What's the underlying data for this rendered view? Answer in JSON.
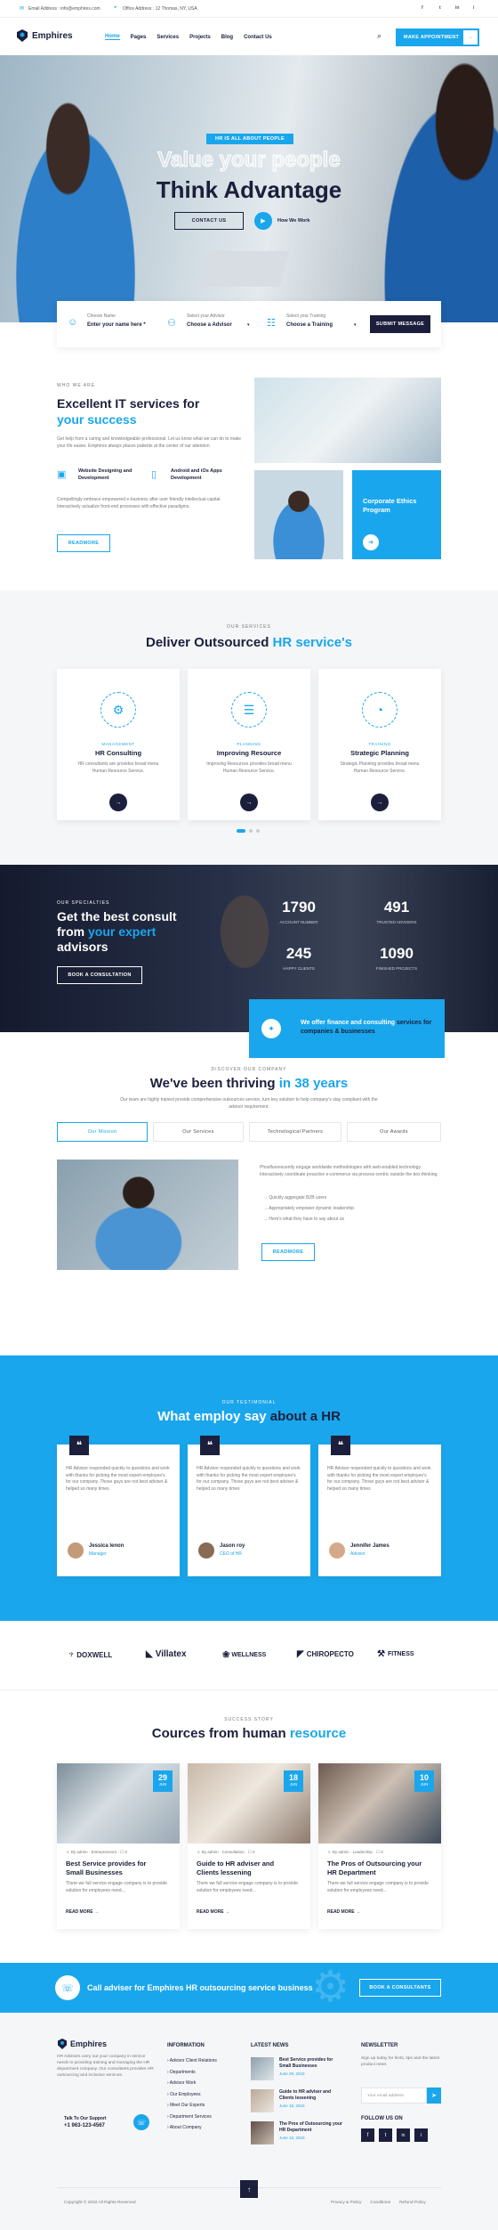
{
  "topbar": {
    "email": "Email Address : info@emphires.com",
    "office": "Office Address : 12 Thomas, NY, USA",
    "social": [
      "f",
      "t",
      "in",
      "i"
    ]
  },
  "header": {
    "logo": "Emphires",
    "nav": [
      "Home",
      "Pages",
      "Services",
      "Projects",
      "Blog",
      "Contact Us"
    ],
    "cta": "MAKE APPOINTMENT"
  },
  "hero": {
    "badge": "HR IS ALL ABOUT PEOPLE",
    "title1": "Value your people",
    "title2": "Think Advantage",
    "contact": "CONTACT US",
    "how": "How We Work"
  },
  "form": {
    "f1_label": "Choose Name",
    "f1_value": "Enter your name here *",
    "f2_label": "Select your Advisor",
    "f2_value": "Choose a Advisor",
    "f3_label": "Select your Training",
    "f3_value": "Choose a Training",
    "submit": "SUBMIT MESSAGE"
  },
  "about": {
    "sub": "WHO WE ARE",
    "title1": "Excellent IT services for",
    "title2": "your success",
    "text": "Get help from a caring and knowledgeable professional. Let us know what we can do to make your life easier. Emphires always places patients at the center of our attention.",
    "f1": "Website Designing and Development",
    "f2": "Android and iOs Apps Development",
    "text2": "Compellingly embrace empowered e-business after user friendly intellectual capital. Interactively actualize front-end processes with effective paradigms.",
    "btn": "READMORE",
    "card": "Corporate Ethics Program"
  },
  "services": {
    "sub": "OUR SERVICES",
    "title1": "Deliver Outsourced ",
    "title2": "HR service's",
    "items": [
      {
        "cat": "MANAGEMENT",
        "title": "HR Consulting",
        "text": "HR consultants are provides broad menu Human Resource Service."
      },
      {
        "cat": "PLANNING",
        "title": "Improving Resource",
        "text": "Improving Resources provides broad menu Human Resource Service."
      },
      {
        "cat": "TRAINING",
        "title": "Strategic Planning",
        "text": "Strategic Planning provides broad menu Human Resource Service."
      }
    ]
  },
  "stats": {
    "sub": "OUR SPECIALTIES",
    "title1": "Get the best consult",
    "title2": "from ",
    "title3": "your expert",
    "title4": "advisors",
    "btn": "BOOK A CONSULTATION",
    "items": [
      {
        "num": "1790",
        "label": "ACCOUNT NUMBER"
      },
      {
        "num": "491",
        "label": "TRUSTED ADVISERS"
      },
      {
        "num": "245",
        "label": "HAPPY CLIENTS"
      },
      {
        "num": "1090",
        "label": "FINISHED PROJECTS"
      }
    ],
    "box1": "We offer finance and consulting ",
    "box2": "services for",
    "box3": "companies & businesses"
  },
  "thriving": {
    "sub": "DISCOVER OUR COMPANY",
    "title1": "We've been thriving ",
    "title2": "in 38 years",
    "text": "Our team are highly trained provide comprehensive outsources service, turn key solution to help company's stay compliant with the advisor requirement.",
    "tabs": [
      "Our Mission",
      "Our Services",
      "Technological Partners",
      "Our Awards"
    ],
    "para": "Phosfluorescently engage worldwide methodologies with web-enabled technology. Interactively coordinate proactive e-commerce via process-centric outside the box thinking.",
    "bullets": [
      "Quickly aggregate B2B users",
      "Appropriately empower dynamic leadership",
      "Here's what they have to say about us"
    ],
    "btn": "READMORE"
  },
  "testimonials": {
    "sub": "OUR TESTIMONIAL",
    "title1": "What employ say ",
    "title2": "about a HR",
    "text": "HR Advisor responded quickly to questions and work with thanks for picking the most expert employee's for our company. Those guys are not best adviser & helped so many times",
    "items": [
      {
        "name": "Jessica lenon",
        "role": "Manager"
      },
      {
        "name": "Jason roy",
        "role": "CEO of HR"
      },
      {
        "name": "Jennifer James",
        "role": "Advisor"
      }
    ]
  },
  "clients": [
    "DOXWELL",
    "Villatex",
    "WELLNESS",
    "CHIROPECTO",
    "FITNESS"
  ],
  "blog": {
    "sub": "SUCCESS STORY",
    "title1": "Cources from human ",
    "title2": "resource",
    "more": "READ MORE",
    "text": "There we full service engage company is to provide solution for employees need...",
    "items": [
      {
        "day": "29",
        "mon": "JUN",
        "meta1": "By admin",
        "meta2": "Entrepreneurs",
        "meta3": "0",
        "title1": "Best Service provides for",
        "title2": "Small Businesses"
      },
      {
        "day": "18",
        "mon": "JUN",
        "meta1": "By admin",
        "meta2": "Consultation",
        "meta3": "0",
        "title1": "Guide to HR adviser and",
        "title2": "Clients lessening"
      },
      {
        "day": "10",
        "mon": "JUN",
        "meta1": "By admin",
        "meta2": "Leadership",
        "meta3": "0",
        "title1": "The Pros of Outsourcing your",
        "title2": "HR Department"
      }
    ]
  },
  "callbar": {
    "text": "Call adviser for Emphires HR outsourcing service business",
    "btn": "BOOK A CONSULTANTS"
  },
  "footer": {
    "logo": "Emphires",
    "about": "HR Advisors carry out your company in service needs to providing training and managing the HR department company. Our consultants provides HR outsourcing and inclusive services.",
    "support_label": "Talk To Our Support",
    "phone": "+1 963-123-4567",
    "info_title": "INFORMATION",
    "info": [
      "Advisor Client Relations",
      "Departments",
      "Advisor Work",
      "Our Employees",
      "Meet Our Experts",
      "Department Services",
      "About Company"
    ],
    "news_title": "LATEST NEWS",
    "news": [
      {
        "t": "Best Service provides for Small Businesses",
        "d": "June 29, 2019"
      },
      {
        "t": "Guide to HR adviser and Clients lessening",
        "d": "June 18, 2019"
      },
      {
        "t": "The Pros of Outsourcing your HR Department",
        "d": "June 10, 2019"
      }
    ],
    "newsletter_title": "NEWSLETTER",
    "newsletter_text": "Sign up today for hints, tips and the latest product news",
    "email_ph": "Your email address",
    "follow": "FOLLOW US ON",
    "copyright": "Copyright © 2022 All Rights Reserved",
    "links": [
      "Privacy & Policy",
      "Conditions",
      "Refund Policy"
    ]
  },
  "colors": {
    "accent": "#1aa6ec",
    "dark": "#1b1f3b"
  }
}
